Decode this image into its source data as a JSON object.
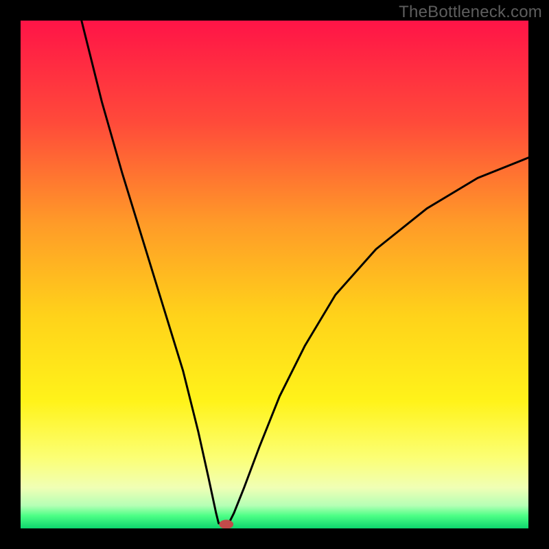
{
  "watermark": "TheBottleneck.com",
  "chart_data": {
    "type": "line",
    "title": "",
    "xlabel": "",
    "ylabel": "",
    "xlim": [
      0,
      100
    ],
    "ylim": [
      0,
      100
    ],
    "curve": {
      "name": "bottleneck-curve",
      "min_x": 40,
      "points": [
        {
          "x": 12,
          "y": 100
        },
        {
          "x": 16,
          "y": 84
        },
        {
          "x": 20,
          "y": 70
        },
        {
          "x": 24,
          "y": 57
        },
        {
          "x": 28,
          "y": 44
        },
        {
          "x": 32,
          "y": 31
        },
        {
          "x": 35,
          "y": 19
        },
        {
          "x": 37,
          "y": 10
        },
        {
          "x": 38.5,
          "y": 3
        },
        {
          "x": 39,
          "y": 1
        },
        {
          "x": 40,
          "y": 1
        },
        {
          "x": 41,
          "y": 1
        },
        {
          "x": 42,
          "y": 3
        },
        {
          "x": 44,
          "y": 8
        },
        {
          "x": 47,
          "y": 16
        },
        {
          "x": 51,
          "y": 26
        },
        {
          "x": 56,
          "y": 36
        },
        {
          "x": 62,
          "y": 46
        },
        {
          "x": 70,
          "y": 55
        },
        {
          "x": 80,
          "y": 63
        },
        {
          "x": 90,
          "y": 69
        },
        {
          "x": 100,
          "y": 73
        }
      ]
    },
    "marker": {
      "x": 40.5,
      "y": 0.8,
      "rx": 1.4,
      "ry": 0.9,
      "fill": "#c24a4a"
    },
    "gradient_stops": [
      {
        "offset": 0,
        "color": "#ff1447"
      },
      {
        "offset": 20,
        "color": "#ff4a3a"
      },
      {
        "offset": 40,
        "color": "#ff9b28"
      },
      {
        "offset": 58,
        "color": "#ffd21a"
      },
      {
        "offset": 75,
        "color": "#fff31a"
      },
      {
        "offset": 86,
        "color": "#fcff74"
      },
      {
        "offset": 92,
        "color": "#f0ffb5"
      },
      {
        "offset": 95.5,
        "color": "#b5ffb5"
      },
      {
        "offset": 97.5,
        "color": "#4dff86"
      },
      {
        "offset": 100,
        "color": "#0dd66e"
      }
    ]
  }
}
